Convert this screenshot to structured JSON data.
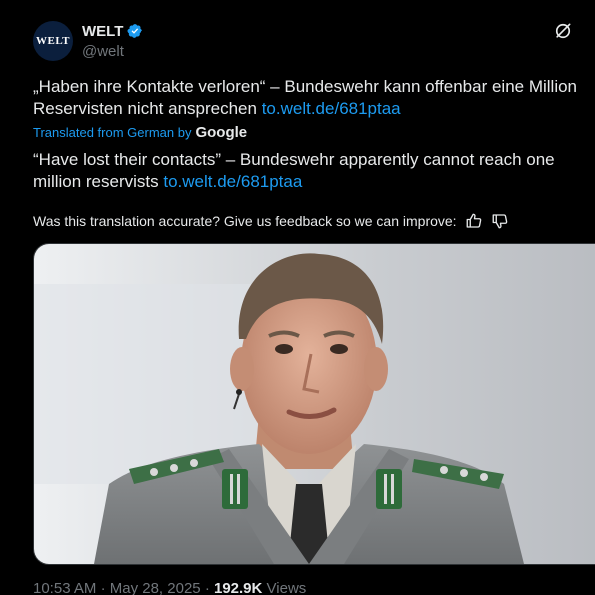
{
  "author": {
    "avatar_text": "WELT",
    "display_name": "WELT",
    "handle": "@welt",
    "verified_color": "#1d9bf0"
  },
  "tweet": {
    "original_text": "„Haben ihre Kontakte verloren“ – Bundeswehr kann offenbar eine Million",
    "original_text_line2": "Reservisten nicht ansprechen",
    "original_link": "to.welt.de/681ptaa",
    "translated_from": "Translated from German by",
    "translator": "Google",
    "translated_text": "“Have lost their contacts” – Bundeswehr apparently cannot reach one",
    "translated_text_line2": "million reservists",
    "translated_link": "to.welt.de/681ptaa",
    "feedback_prompt": "Was this translation accurate? Give us feedback so we can improve:"
  },
  "meta": {
    "time": "10:53 AM",
    "sep1": "·",
    "date": "May 28, 2025",
    "sep2": "·",
    "views_count": "192.9K",
    "views_label": "Views"
  },
  "icons": {
    "grok": "grok-icon",
    "thumbs_up": "thumbs-up-icon",
    "thumbs_down": "thumbs-down-icon",
    "verified": "verified-badge-icon"
  },
  "colors": {
    "background": "#000000",
    "text": "#e7e9ea",
    "secondary": "#71767b",
    "link": "#1d9bf0",
    "avatar_bg": "#0b1f3d"
  }
}
